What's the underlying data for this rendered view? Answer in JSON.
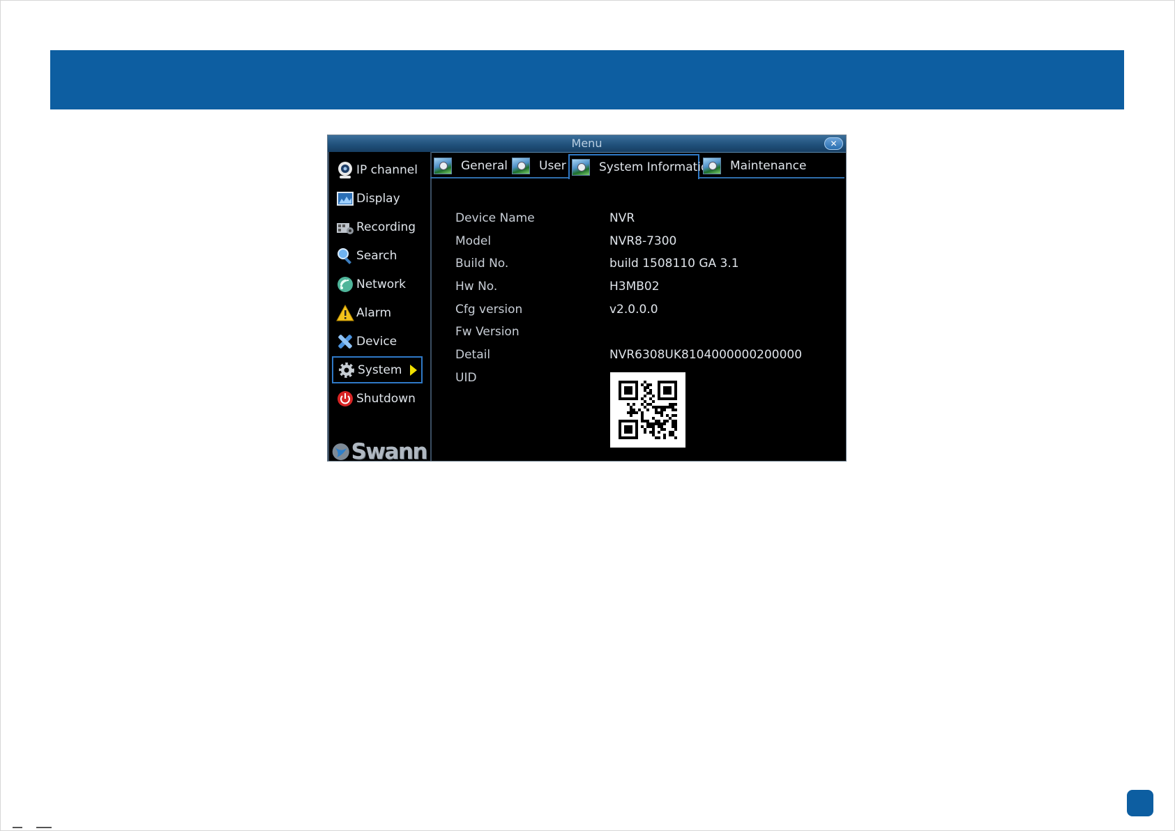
{
  "window": {
    "title": "Menu",
    "close_label": "✕"
  },
  "sidebar": {
    "items": [
      {
        "label": "IP channel",
        "icon": "webcam-icon"
      },
      {
        "label": "Display",
        "icon": "display-icon"
      },
      {
        "label": "Recording",
        "icon": "recording-icon"
      },
      {
        "label": "Search",
        "icon": "search-icon"
      },
      {
        "label": "Network",
        "icon": "network-icon"
      },
      {
        "label": "Alarm",
        "icon": "alarm-icon"
      },
      {
        "label": "Device",
        "icon": "device-icon"
      },
      {
        "label": "System",
        "icon": "gear-icon",
        "selected": true
      },
      {
        "label": "Shutdown",
        "icon": "power-icon"
      }
    ],
    "logo": "Swann"
  },
  "tabs": [
    {
      "label": "General"
    },
    {
      "label": "User"
    },
    {
      "label": "System Information",
      "active": true
    },
    {
      "label": "Maintenance"
    }
  ],
  "info": {
    "rows": [
      {
        "label": "Device Name",
        "value": "NVR"
      },
      {
        "label": "Model",
        "value": "NVR8-7300"
      },
      {
        "label": "Build No.",
        "value": "build 1508110 GA 3.1"
      },
      {
        "label": "Hw No.",
        "value": "H3MB02"
      },
      {
        "label": "Cfg version",
        "value": "v2.0.0.0"
      },
      {
        "label": "Fw Version",
        "value": ""
      },
      {
        "label": "Detail",
        "value": "NVR6308UK8104000000200000"
      },
      {
        "label": "UID",
        "value": ""
      }
    ]
  },
  "colors": {
    "banner": "#0d5ea1",
    "accent": "#2f79c7",
    "selection_arrow": "#f1e000"
  }
}
